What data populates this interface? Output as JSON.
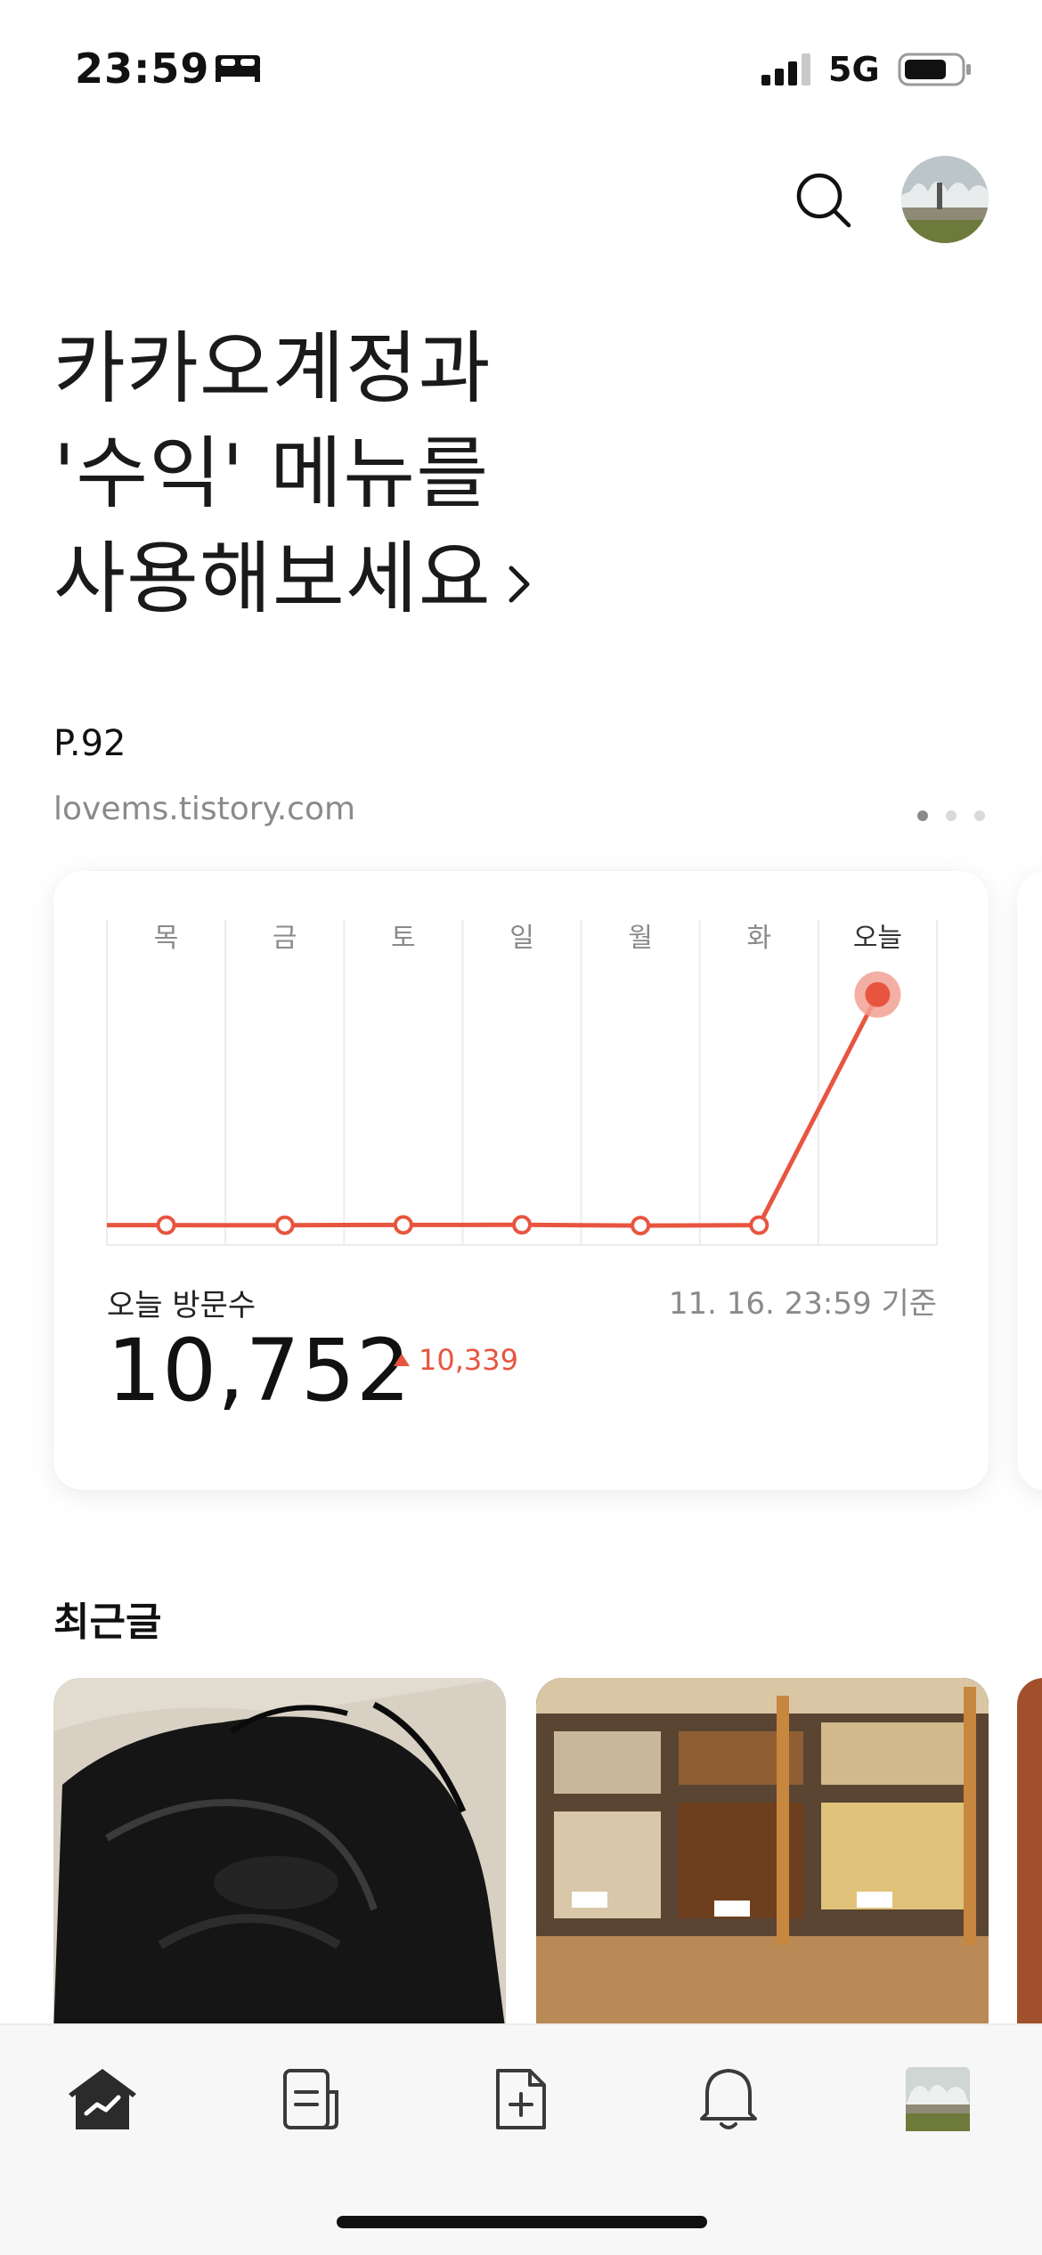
{
  "status_bar": {
    "time": "23:59",
    "network": "5G",
    "icons": [
      "bed-icon",
      "signal-icon",
      "battery-icon"
    ]
  },
  "header": {
    "search_icon": "search-icon",
    "avatar": "profile-avatar"
  },
  "hero": {
    "line1": "카카오계정과",
    "line2": "'수익' 메뉴를",
    "line3": "사용해보세요",
    "chevron_icon": "chevron-right-icon"
  },
  "blog": {
    "name": "P.92",
    "url": "lovems.tistory.com",
    "pager": {
      "pages": 3,
      "active": 1
    }
  },
  "stats": {
    "label": "오늘 방문수",
    "as_of": "11. 16. 23:59 기준",
    "value": "10,752",
    "delta": "10,339",
    "delta_icon": "triangle-up-icon"
  },
  "chart_data": {
    "type": "line",
    "categories": [
      "목",
      "금",
      "토",
      "일",
      "월",
      "화",
      "오늘"
    ],
    "series": [
      {
        "values": [
          413,
          410,
          425,
          428,
          395,
          413,
          10752
        ]
      }
    ],
    "ylim": [
      0,
      11500
    ],
    "grid": true,
    "colors": {
      "line": "#e8553f",
      "highlight": "#f2a195",
      "grid": "#ececec"
    }
  },
  "recent": {
    "title": "최근글",
    "posts": [
      {
        "image": "black-leather-drawstring-bag"
      },
      {
        "image": "bakery-display-counter"
      },
      {
        "image": "pastry-partial"
      }
    ]
  },
  "tabbar": {
    "items": [
      {
        "icon": "dashboard-chart-icon",
        "active": true
      },
      {
        "icon": "posts-document-icon",
        "active": false
      },
      {
        "icon": "new-post-icon",
        "active": false
      },
      {
        "icon": "notification-bell-icon",
        "active": false
      },
      {
        "icon": "profile-avatar-icon",
        "active": false
      }
    ]
  },
  "colors": {
    "accent": "#e8553f",
    "text_primary": "#111111",
    "text_secondary": "#8a8a8a"
  }
}
